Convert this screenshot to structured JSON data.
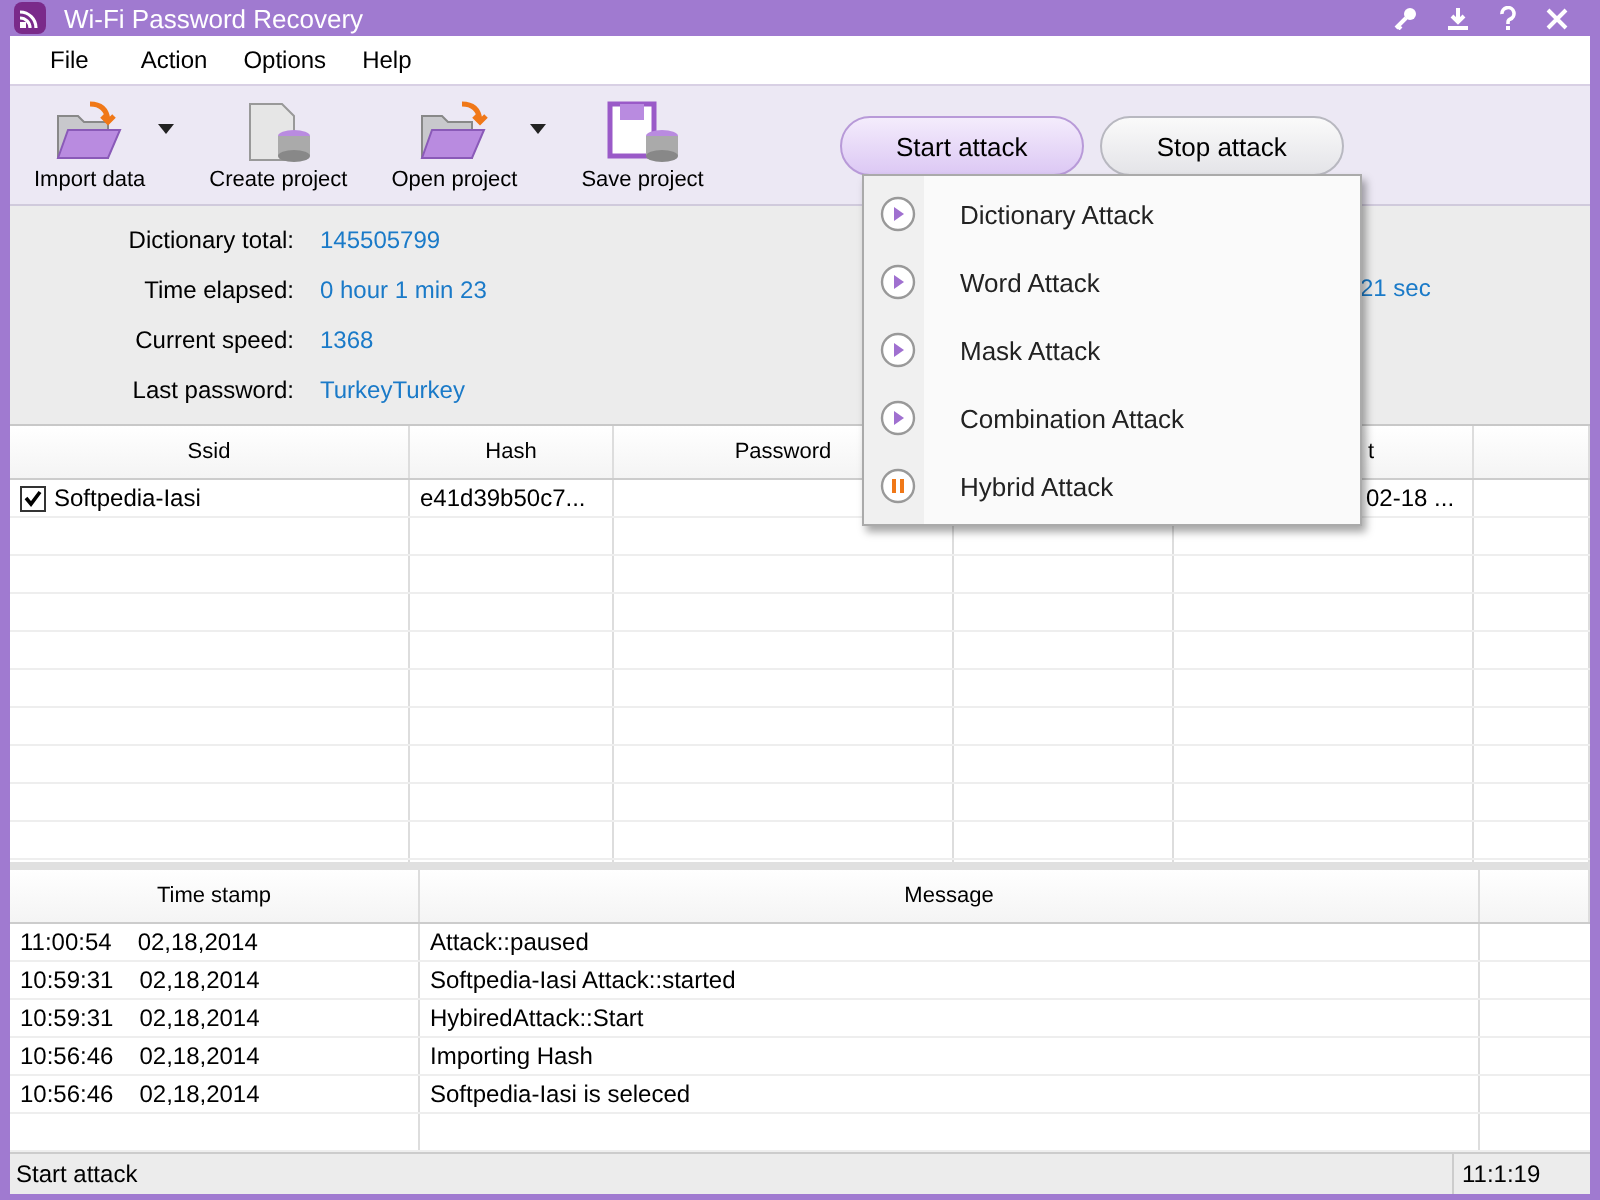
{
  "window": {
    "title": "Wi-Fi Password Recovery"
  },
  "menu_bar": [
    "File",
    "Action",
    "Options",
    "Help"
  ],
  "toolbar": [
    {
      "label": "Import data",
      "kind": "import",
      "dropdown": true
    },
    {
      "label": "Create project",
      "kind": "create",
      "dropdown": false
    },
    {
      "label": "Open project",
      "kind": "open",
      "dropdown": true
    },
    {
      "label": "Save project",
      "kind": "save",
      "dropdown": false
    }
  ],
  "attack_buttons": [
    {
      "label": "Start attack",
      "selected": true
    },
    {
      "label": "Stop attack",
      "selected": false
    }
  ],
  "attack_menu": [
    {
      "label": "Dictionary Attack",
      "kind": "play"
    },
    {
      "label": "Word Attack",
      "kind": "play"
    },
    {
      "label": "Mask Attack",
      "kind": "play"
    },
    {
      "label": "Combination Attack",
      "kind": "play"
    },
    {
      "label": "Hybrid Attack",
      "kind": "pause"
    }
  ],
  "stats": [
    {
      "label": "Dictionary total:",
      "value": "145505799"
    },
    {
      "label": "Time elapsed:",
      "value": "0 hour 1 min 23"
    },
    {
      "label": "Current speed:",
      "value": "1368"
    },
    {
      "label": "Last password:",
      "value": "TurkeyTurkey"
    }
  ],
  "stats_right_value": "21 sec",
  "table": {
    "columns": [
      "Ssid",
      "Hash",
      "Password",
      "",
      "t",
      ""
    ],
    "rows": [
      {
        "checked": true,
        "cells": [
          "Softpedia-Iasi",
          "e41d39b50c7...",
          "",
          "",
          "02-18 ...",
          ""
        ]
      }
    ]
  },
  "log": {
    "columns": [
      "Time stamp",
      "Message"
    ],
    "rows": [
      {
        "time": "11:00:54",
        "date": "02,18,2014",
        "message": "Attack::paused"
      },
      {
        "time": "10:59:31",
        "date": "02,18,2014",
        "message": "Softpedia-Iasi Attack::started"
      },
      {
        "time": "10:59:31",
        "date": "02,18,2014",
        "message": "HybiredAttack::Start"
      },
      {
        "time": "10:56:46",
        "date": "02,18,2014",
        "message": "Importing Hash"
      },
      {
        "time": "10:56:46",
        "date": "02,18,2014",
        "message": "Softpedia-Iasi is seleced"
      }
    ]
  },
  "status_bar": {
    "message": "Start attack",
    "time": "11:1:19"
  }
}
